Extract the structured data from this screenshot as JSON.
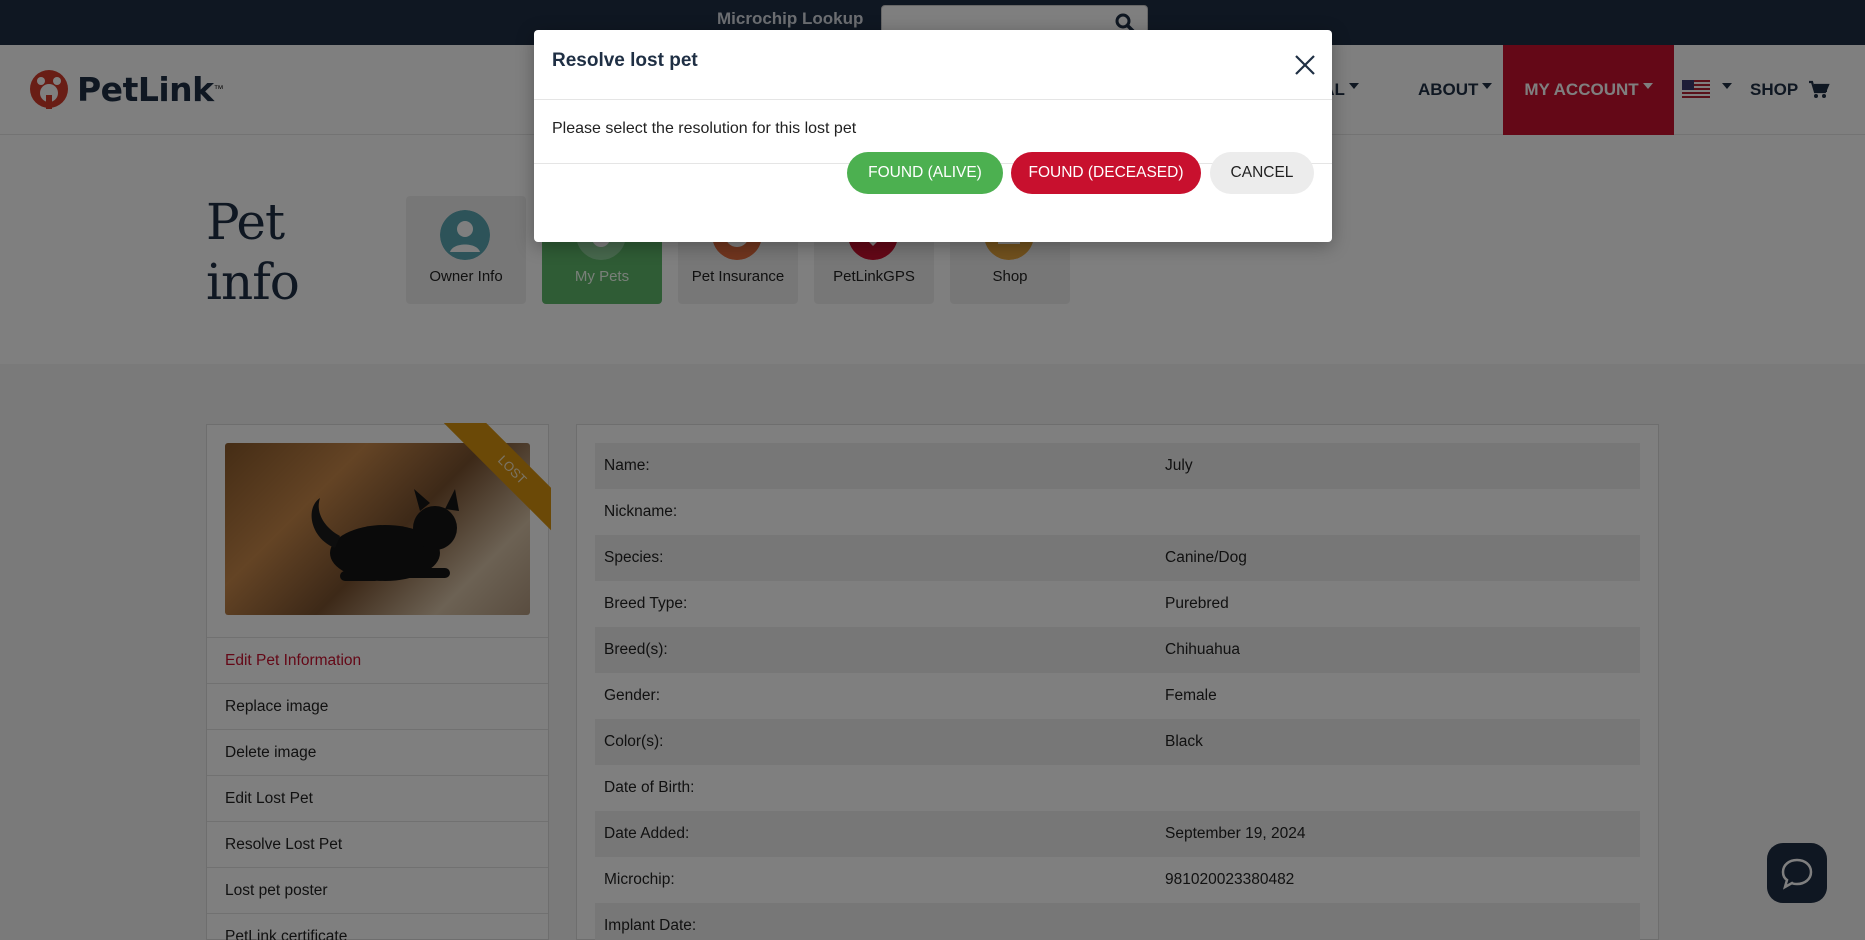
{
  "topbar": {
    "lookup_label": "Microchip Lookup",
    "lookup_placeholder": ""
  },
  "header": {
    "brand": "PetLink",
    "nav": {
      "international": "NAL",
      "about": "ABOUT",
      "my_account": "MY ACCOUNT",
      "shop": "SHOP"
    }
  },
  "page": {
    "title_line1": "Pet",
    "title_line2": "info",
    "tiles": [
      {
        "label": "Owner Info"
      },
      {
        "label": "My Pets"
      },
      {
        "label": "Pet Insurance"
      },
      {
        "label": "PetLinkGPS"
      },
      {
        "label": "Shop"
      }
    ]
  },
  "sidebar": {
    "ribbon": "LOST",
    "links": [
      "Edit Pet Information",
      "Replace image",
      "Delete image",
      "Edit Lost Pet",
      "Resolve Lost Pet",
      "Lost pet poster",
      "PetLink certificate"
    ]
  },
  "details": {
    "rows": [
      {
        "key": "Name:",
        "value": "July"
      },
      {
        "key": "Nickname:",
        "value": ""
      },
      {
        "key": "Species:",
        "value": "Canine/Dog"
      },
      {
        "key": "Breed Type:",
        "value": "Purebred"
      },
      {
        "key": "Breed(s):",
        "value": "Chihuahua"
      },
      {
        "key": "Gender:",
        "value": "Female"
      },
      {
        "key": "Color(s):",
        "value": "Black"
      },
      {
        "key": "Date of Birth:",
        "value": ""
      },
      {
        "key": "Date Added:",
        "value": "September 19, 2024"
      },
      {
        "key": "Microchip:",
        "value": "981020023380482"
      },
      {
        "key": "Implant Date:",
        "value": ""
      }
    ]
  },
  "modal": {
    "title": "Resolve lost pet",
    "message": "Please select the resolution for this lost pet",
    "found_alive": "FOUND (ALIVE)",
    "found_deceased": "FOUND (DECEASED)",
    "cancel": "CANCEL"
  },
  "colors": {
    "navy": "#1f2f44",
    "brand_red": "#c8102e",
    "green": "#4cb050",
    "ribbon": "#d7930f"
  }
}
